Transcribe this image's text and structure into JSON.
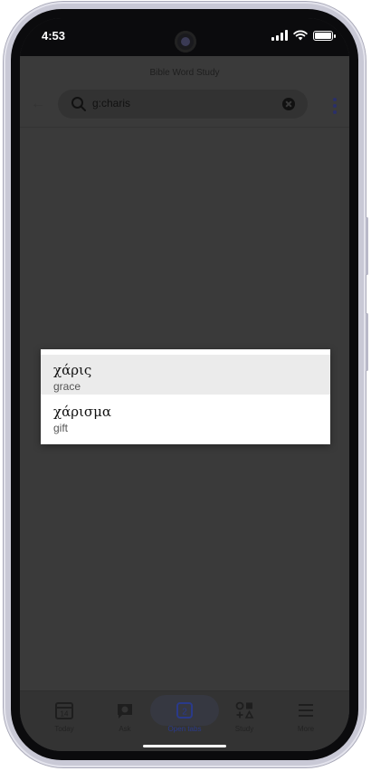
{
  "status_bar": {
    "time": "4:53"
  },
  "header": {
    "title": "Bible Word Study",
    "search": {
      "value": "g:charis"
    }
  },
  "results": [
    {
      "word": "χάρις",
      "gloss": "grace",
      "selected": true
    },
    {
      "word": "χάρισμα",
      "gloss": "gift",
      "selected": false
    }
  ],
  "bottom_nav": {
    "items": [
      {
        "label": "Today",
        "icon": "calendar-icon",
        "badge": "14"
      },
      {
        "label": "Ask",
        "icon": "chat-icon"
      },
      {
        "label": "Open tabs",
        "icon": "tabs-icon",
        "badge": "2",
        "active": true
      },
      {
        "label": "Study",
        "icon": "study-icon"
      },
      {
        "label": "More",
        "icon": "menu-icon"
      }
    ]
  },
  "colors": {
    "overlay": "#3a3a3a",
    "accent": "#2a3a8a",
    "popup_bg": "#ffffff",
    "selected_row": "#ebebeb"
  }
}
